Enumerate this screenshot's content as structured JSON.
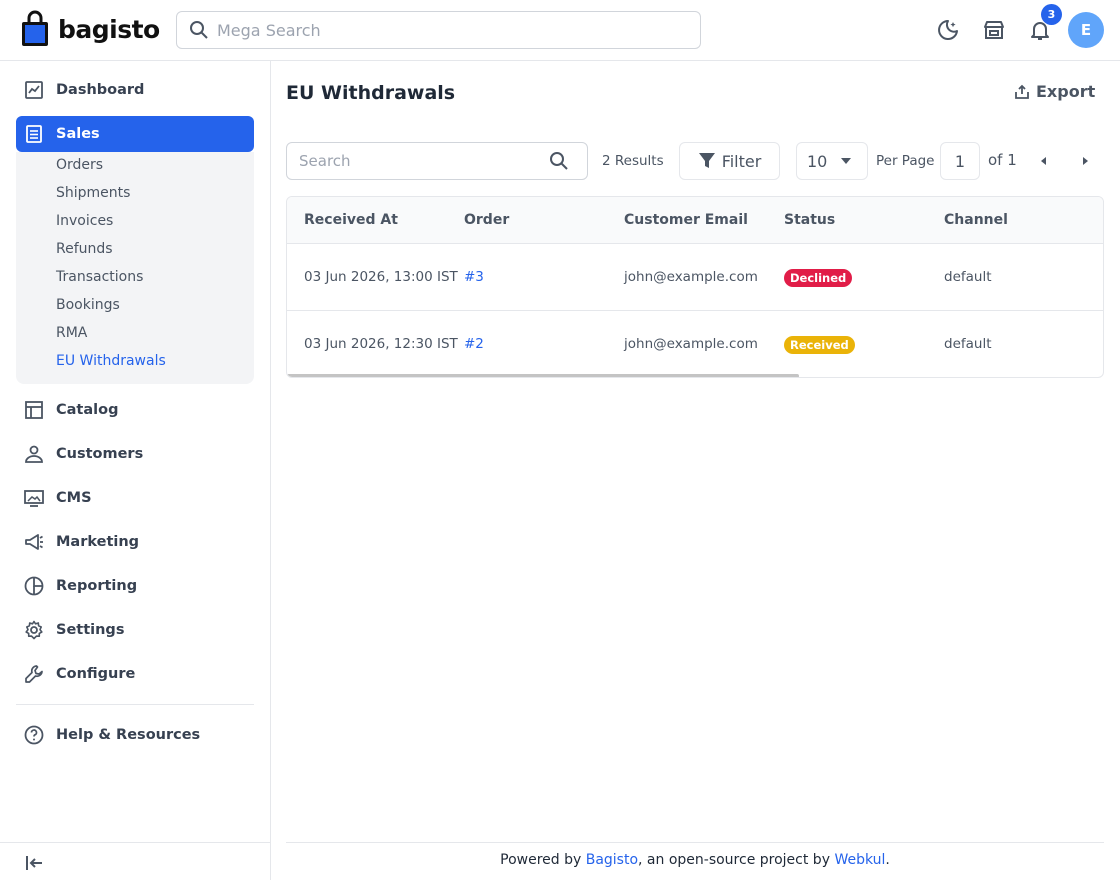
{
  "header": {
    "brand": "bagisto",
    "search_placeholder": "Mega Search",
    "notification_count": "3",
    "avatar_initial": "E",
    "brand_color": "#2563eb"
  },
  "sidebar": {
    "items": [
      {
        "label": "Dashboard",
        "icon": "dashboard-icon"
      },
      {
        "label": "Sales",
        "icon": "sales-icon",
        "active": true
      },
      {
        "label": "Catalog",
        "icon": "catalog-icon"
      },
      {
        "label": "Customers",
        "icon": "customers-icon"
      },
      {
        "label": "CMS",
        "icon": "cms-icon"
      },
      {
        "label": "Marketing",
        "icon": "marketing-icon"
      },
      {
        "label": "Reporting",
        "icon": "reporting-icon"
      },
      {
        "label": "Settings",
        "icon": "settings-icon"
      },
      {
        "label": "Configure",
        "icon": "configure-icon"
      },
      {
        "label": "Help & Resources",
        "icon": "help-icon"
      }
    ],
    "sales_submenu": [
      "Orders",
      "Shipments",
      "Invoices",
      "Refunds",
      "Transactions",
      "Bookings",
      "RMA",
      "EU Withdrawals"
    ],
    "current_submenu": "EU Withdrawals"
  },
  "main": {
    "title": "EU Withdrawals",
    "export_label": "Export",
    "search_placeholder": "Search",
    "results_text": "2 Results",
    "filter_label": "Filter",
    "per_page_value": "10",
    "per_page_label": "Per Page",
    "page_value": "1",
    "of_label": "of 1"
  },
  "table": {
    "columns": [
      "Received At",
      "Order",
      "Customer Email",
      "Status",
      "Channel"
    ],
    "rows": [
      {
        "received_at": "03 Jun 2026, 13:00 IST",
        "order": "#3",
        "email": "john@example.com",
        "status": "Declined",
        "status_color": "#e11d48",
        "channel": "default"
      },
      {
        "received_at": "03 Jun 2026, 12:30 IST",
        "order": "#2",
        "email": "john@example.com",
        "status": "Received",
        "status_color": "#eab308",
        "channel": "default"
      }
    ]
  },
  "footer": {
    "prefix": "Powered by ",
    "link1": "Bagisto",
    "middle": ", an open-source project by ",
    "link2": "Webkul",
    "suffix": "."
  }
}
